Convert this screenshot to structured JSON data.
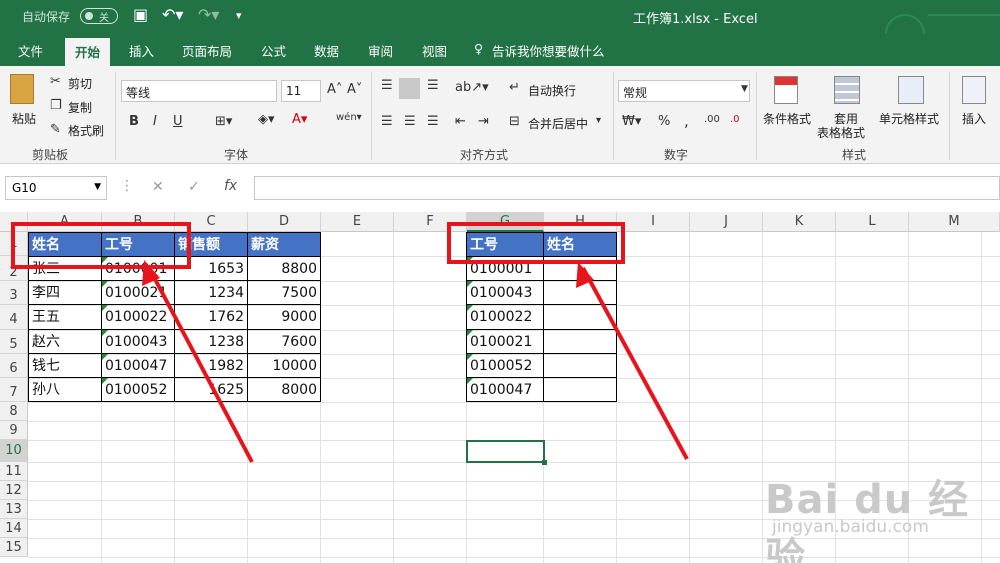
{
  "titlebar": {
    "autosave_label": "自动保存",
    "autosave_state": "关",
    "file_title": "工作簿1.xlsx  -  Excel"
  },
  "tabs": [
    "文件",
    "开始",
    "插入",
    "页面布局",
    "公式",
    "数据",
    "审阅",
    "视图"
  ],
  "tell_me": "告诉我你想要做什么",
  "ribbon": {
    "clipboard": {
      "paste": "粘贴",
      "cut": "剪切",
      "copy": "复制",
      "format_painter": "格式刷",
      "group": "剪贴板"
    },
    "font": {
      "name": "等线",
      "size": "11",
      "group": "字体",
      "bold": "B",
      "italic": "I",
      "underline": "U"
    },
    "alignment": {
      "wrap": "自动换行",
      "merge": "合并后居中",
      "group": "对齐方式"
    },
    "number": {
      "format": "常规",
      "group": "数字",
      "percent": "%",
      "comma": ","
    },
    "styles": {
      "conditional": "条件格式",
      "table": "套用",
      "table2": "表格格式",
      "cell_styles": "单元格样式",
      "group": "样式"
    },
    "cells": {
      "insert": "插入"
    }
  },
  "formula_bar": {
    "name_box": "G10",
    "fx": "fx",
    "value": ""
  },
  "columns": [
    "A",
    "B",
    "C",
    "D",
    "E",
    "F",
    "G",
    "H",
    "I",
    "J",
    "K",
    "L",
    "M"
  ],
  "rows": [
    "1",
    "2",
    "3",
    "4",
    "5",
    "6",
    "7",
    "8",
    "9",
    "10",
    "11",
    "12",
    "13",
    "14",
    "15"
  ],
  "table1": {
    "headers": [
      "姓名",
      "工号",
      "销售额",
      "薪资"
    ],
    "rows": [
      [
        "张三",
        "0100001",
        "1653",
        "8800"
      ],
      [
        "李四",
        "0100021",
        "1234",
        "7500"
      ],
      [
        "王五",
        "0100022",
        "1762",
        "9000"
      ],
      [
        "赵六",
        "0100043",
        "1238",
        "7600"
      ],
      [
        "钱七",
        "0100047",
        "1982",
        "10000"
      ],
      [
        "孙八",
        "0100052",
        "1625",
        "8000"
      ]
    ]
  },
  "table2": {
    "headers": [
      "工号",
      "姓名"
    ],
    "rows": [
      [
        "0100001",
        ""
      ],
      [
        "0100043",
        ""
      ],
      [
        "0100022",
        ""
      ],
      [
        "0100021",
        ""
      ],
      [
        "0100052",
        ""
      ],
      [
        "0100047",
        ""
      ]
    ]
  },
  "watermark": {
    "brand": "Bai du 经验",
    "url": "jingyan.baidu.com"
  },
  "colors": {
    "excel_green": "#217346",
    "header_blue": "#4472c4",
    "annotation_red": "#e8141b"
  }
}
